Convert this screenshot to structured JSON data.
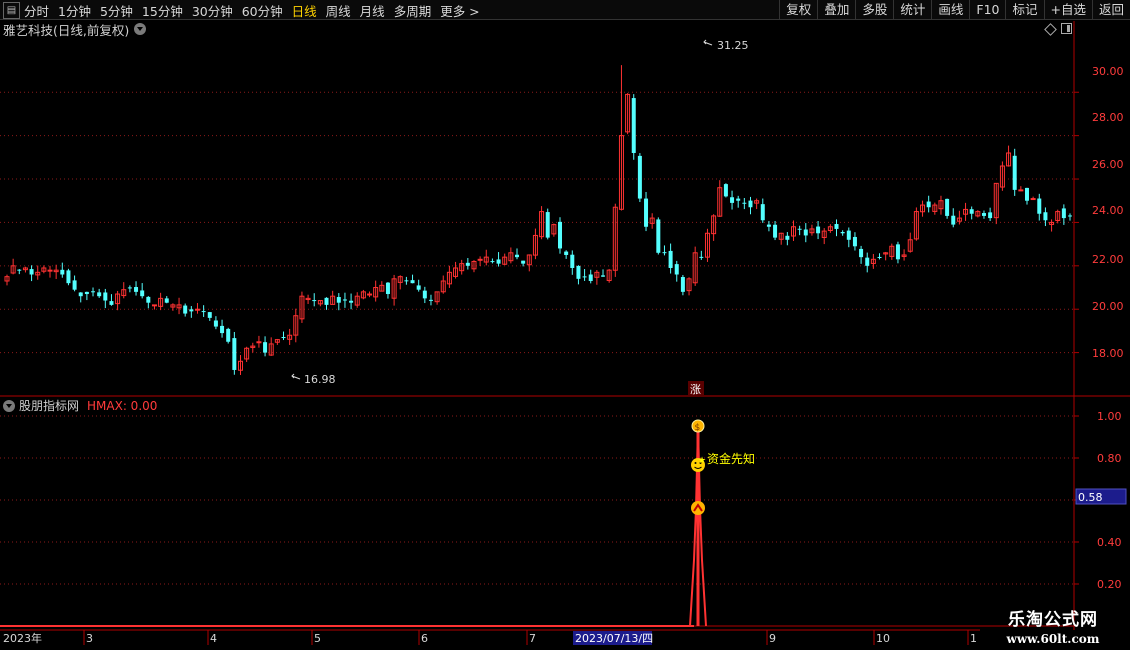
{
  "toolbar": {
    "periods": [
      {
        "label": "分时",
        "active": false
      },
      {
        "label": "1分钟",
        "active": false
      },
      {
        "label": "5分钟",
        "active": false
      },
      {
        "label": "15分钟",
        "active": false
      },
      {
        "label": "30分钟",
        "active": false
      },
      {
        "label": "60分钟",
        "active": false
      },
      {
        "label": "日线",
        "active": true
      },
      {
        "label": "周线",
        "active": false
      },
      {
        "label": "月线",
        "active": false
      },
      {
        "label": "多周期",
        "active": false
      },
      {
        "label": "更多 >",
        "active": false
      }
    ],
    "right_buttons": [
      "复权",
      "叠加",
      "多股",
      "统计",
      "画线",
      "F10",
      "标记",
      "+自选",
      "返回"
    ]
  },
  "main_chart": {
    "title": "雅艺科技(日线,前复权)",
    "high_label": "31.25",
    "low_label": "16.98",
    "limit_up_marker": "涨",
    "y_ticks": [
      "30.00",
      "28.00",
      "26.00",
      "24.00",
      "22.00",
      "20.00",
      "18.00"
    ]
  },
  "indicator": {
    "name": "股朋指标网",
    "value_text": "HMAX: 0.00",
    "annotation": "资金先知",
    "y_ticks": [
      "1.00",
      "0.80",
      "0.40",
      "0.20"
    ],
    "current_value": "0.58"
  },
  "date_axis": {
    "labels": [
      "2023年",
      "3",
      "4",
      "5",
      "6",
      "7",
      "9",
      "10",
      "1"
    ],
    "cursor_date": "2023/07/13/四"
  },
  "watermark": {
    "line1": "乐淘公式网",
    "line2": "www.60lt.com"
  },
  "colors": {
    "up": "#ff3232",
    "down": "#54ffff",
    "grid": "#8b1a1a",
    "axis": "#b00000",
    "active_period": "#ffd200",
    "annotation": "#ffff00",
    "cursor_bg": "#1c1c8c"
  },
  "chart_data": {
    "type": "candlestick",
    "title": "雅艺科技(日线,前复权)",
    "ylim": [
      16.0,
      32.5
    ],
    "y_ticks": [
      18,
      20,
      22,
      24,
      26,
      28,
      30
    ],
    "high": 31.25,
    "low": 16.98,
    "closes": [
      21.5,
      22.0,
      21.8,
      21.9,
      21.6,
      21.7,
      21.9,
      21.8,
      21.8,
      21.6,
      21.2,
      20.9,
      20.6,
      20.7,
      20.8,
      20.6,
      20.4,
      20.2,
      20.7,
      20.9,
      21.0,
      20.8,
      20.6,
      20.3,
      20.2,
      20.5,
      20.3,
      20.2,
      20.2,
      19.8,
      19.9,
      20.0,
      19.9,
      19.6,
      19.2,
      18.9,
      18.5,
      17.2,
      17.6,
      18.2,
      18.3,
      18.5,
      18.0,
      18.4,
      18.6,
      18.7,
      18.8,
      19.7,
      20.6,
      20.5,
      20.4,
      20.4,
      20.2,
      20.6,
      20.3,
      20.4,
      20.3,
      20.6,
      20.8,
      20.7,
      21.0,
      21.1,
      20.7,
      21.4,
      21.5,
      21.3,
      21.2,
      20.9,
      20.5,
      20.4,
      20.8,
      21.3,
      21.7,
      21.9,
      22.1,
      22.0,
      22.2,
      22.3,
      22.4,
      22.2,
      22.1,
      22.4,
      22.6,
      22.4,
      22.1,
      22.5,
      23.4,
      24.5,
      23.3,
      23.9,
      22.8,
      22.5,
      21.9,
      21.4,
      21.5,
      21.3,
      21.7,
      21.5,
      21.8,
      24.7,
      28.0,
      29.9,
      27.2,
      25.1,
      23.8,
      24.2,
      22.6,
      22.6,
      21.9,
      21.6,
      20.8,
      21.4,
      22.6,
      22.4,
      23.5,
      24.3,
      25.6,
      25.2,
      24.9,
      25.0,
      24.9,
      24.7,
      25.0,
      24.1,
      23.8,
      23.3,
      23.5,
      23.2,
      23.8,
      23.7,
      23.4,
      23.7,
      23.5,
      23.6,
      23.8,
      23.7,
      23.5,
      23.2,
      22.9,
      22.4,
      22.0,
      22.3,
      22.4,
      22.6,
      22.9,
      22.3,
      22.5,
      23.2,
      24.5,
      24.8,
      24.7,
      24.8,
      25.0,
      24.3,
      23.9,
      24.2,
      24.6,
      24.4,
      24.5,
      24.3,
      24.2,
      25.8,
      26.6,
      27.2,
      25.5,
      25.5,
      25.0,
      25.1,
      24.4,
      24.1,
      24.0,
      24.5,
      24.2,
      24.3
    ]
  }
}
